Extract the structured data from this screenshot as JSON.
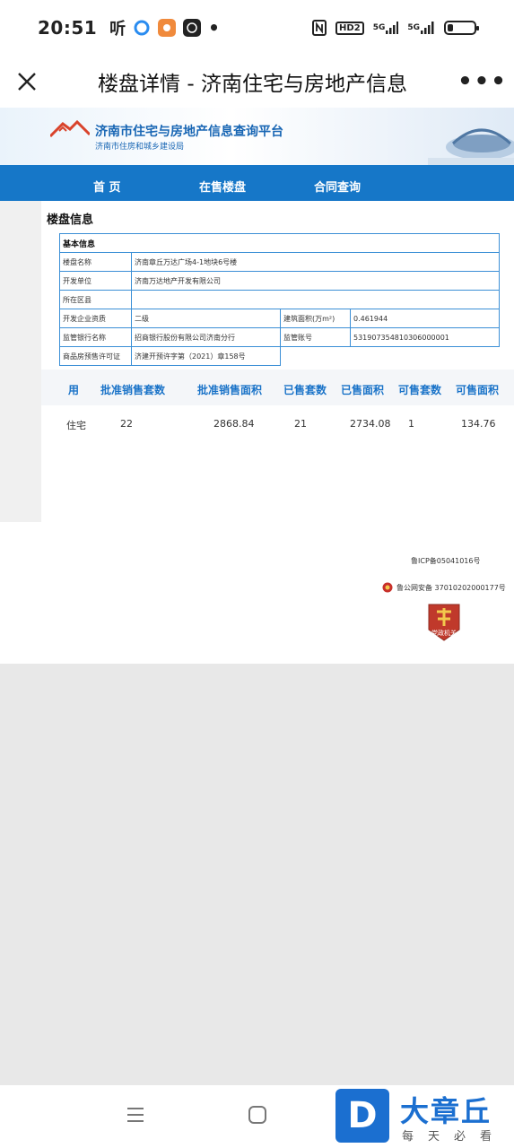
{
  "status_bar": {
    "time": "20:51",
    "listen_icon_text": "听",
    "network_1": "5G",
    "network_2": "5G",
    "hd_label": "HD2",
    "battery_level": 0.2
  },
  "titlebar": {
    "title": "楼盘详情 - 济南住宅与房地产信息",
    "more_label": "•••"
  },
  "site": {
    "banner_title": "济南市住宅与房地产信息查询平台",
    "banner_subtitle": "济南市住房和城乡建设局",
    "nav": [
      "首 页",
      "在售楼盘",
      "合同查询"
    ],
    "section_title": "楼盘信息"
  },
  "basic_info": {
    "header": "基本信息",
    "rows": [
      {
        "label": "楼盘名称",
        "value": "济南章丘万达广场4-1地块6号楼"
      },
      {
        "label": "开发单位",
        "value": "济南万达地产开发有限公司"
      },
      {
        "label": "所在区县",
        "value": ""
      },
      {
        "label": "开发企业资质",
        "value": "二级",
        "label2": "建筑面积(万m²)",
        "value2": "0.461944"
      },
      {
        "label": "监管银行名称",
        "value": "招商银行股份有限公司济南分行",
        "label2": "监管账号",
        "value2": "531907354810306000001"
      },
      {
        "label": "商品房预售许可证",
        "value": "济建开预许字第（2021）章158号"
      }
    ]
  },
  "sales": {
    "headers": [
      "用",
      "批准销售套数",
      "批准销售面积",
      "已售套数",
      "已售面积",
      "可售套数",
      "可售面积"
    ],
    "row": [
      "住宅",
      "22",
      "2868.84",
      "21",
      "2734.08",
      "1",
      "134.76"
    ]
  },
  "footer": {
    "icp": "鲁ICP备05041016号",
    "police": "鲁公网安备 37010202000177号",
    "badge_text": "党政机关"
  },
  "watermark": {
    "logo_letter": "D",
    "title": "大章丘",
    "subtitle": "每天必看"
  },
  "colors": {
    "brand_blue": "#1677c8",
    "table_border": "#3b8fd6",
    "header_blue": "#1a73c8",
    "watermark_blue": "#1b6fd0"
  }
}
